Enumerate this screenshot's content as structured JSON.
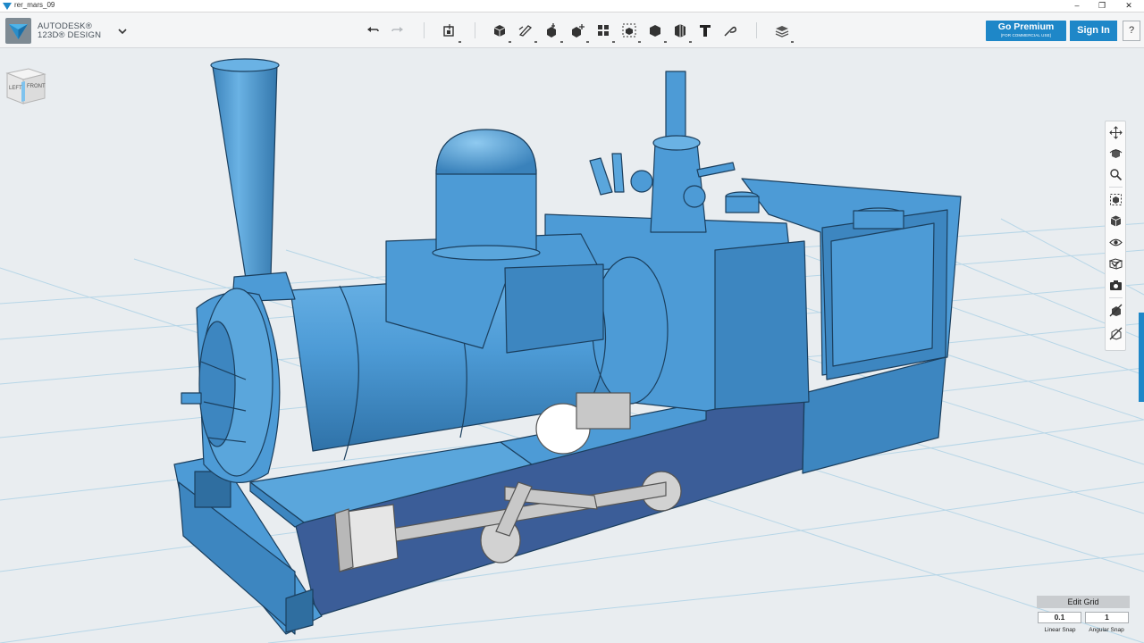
{
  "window": {
    "title": "rer_mars_09",
    "minimize_glyph": "‒",
    "maximize_glyph": "❐",
    "close_glyph": "✕"
  },
  "brand": {
    "line1": "AUTODESK®",
    "line2": "123D® DESIGN",
    "icon": "autodesk-123d-logo"
  },
  "toolbar": {
    "tools": [
      {
        "name": "undo-button",
        "icon": "undo-icon"
      },
      {
        "name": "redo-button",
        "icon": "redo-icon"
      },
      {
        "name": "transform-button",
        "icon": "transform-icon"
      },
      {
        "name": "primitives-button",
        "icon": "primitives-icon"
      },
      {
        "name": "sketch-button",
        "icon": "sketch-icon"
      },
      {
        "name": "construct-button",
        "icon": "construct-icon"
      },
      {
        "name": "modify-button",
        "icon": "modify-icon"
      },
      {
        "name": "pattern-button",
        "icon": "pattern-icon"
      },
      {
        "name": "grouping-button",
        "icon": "grouping-icon"
      },
      {
        "name": "combine-button",
        "icon": "combine-icon"
      },
      {
        "name": "measure-button",
        "icon": "measure-icon"
      },
      {
        "name": "text-button",
        "icon": "text-icon"
      },
      {
        "name": "snap-button",
        "icon": "snap-icon"
      },
      {
        "name": "material-button",
        "icon": "material-icon"
      }
    ]
  },
  "account": {
    "premium_label": "Go Premium",
    "premium_sub": "(FOR COMMERCIAL USE)",
    "signin_label": "Sign In",
    "help_label": "?"
  },
  "viewcube": {
    "left_label": "LEFT",
    "front_label": "FRONT"
  },
  "nav_tools": [
    "pan-icon",
    "orbit-icon",
    "zoom-icon",
    "fit-icon",
    "view-icon",
    "visibility-icon",
    "materials-outlines-icon",
    "camera-icon",
    "mesh-visibility-icon",
    "solids-visibility-icon"
  ],
  "grid": {
    "edit_label": "Edit Grid",
    "linear_value": "0.1",
    "angular_value": "1",
    "linear_caption": "Linear Snap",
    "angular_caption": "Angular Snap"
  },
  "colors": {
    "model": "#4d9bd6",
    "model_dark": "#2f6ea0",
    "frame": "#3b5d98",
    "accent": "#1e87c8",
    "grid": "#bfd9e8"
  }
}
